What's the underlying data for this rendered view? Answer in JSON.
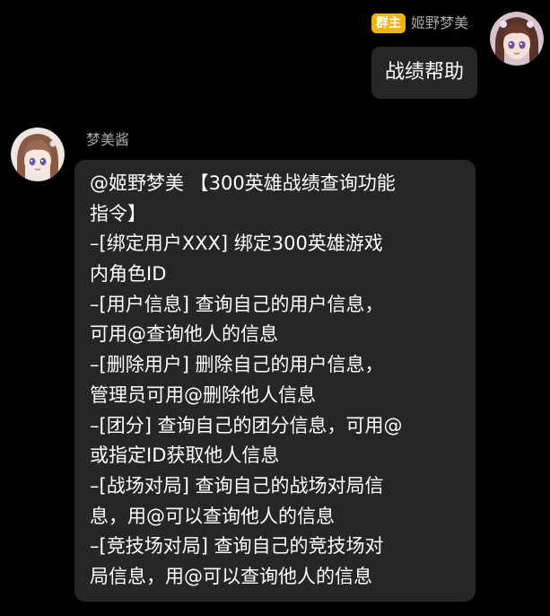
{
  "outgoing": {
    "badge": "群主",
    "sender": "姬野梦美",
    "text": "战绩帮助"
  },
  "incoming": {
    "sender": "梦美酱",
    "lines": [
      "@姬野梦美 【300英雄战绩查询功能",
      "指令】",
      "–[绑定用户XXX] 绑定300英雄游戏",
      "内角色ID",
      "–[用户信息] 查询自己的用户信息，",
      "可用@查询他人的信息",
      "–[删除用户] 删除自己的用户信息，",
      "管理员可用@删除他人信息",
      "–[团分] 查询自己的团分信息，可用@",
      "或指定ID获取他人信息",
      "–[战场对局] 查询自己的战场对局信",
      "息，用@可以查询他人的信息",
      "–[竞技场对局] 查询自己的竞技场对",
      "局信息，用@可以查询他人的信息"
    ]
  },
  "colors": {
    "background": "#000000",
    "bubble": "#262626",
    "badge": "#f2b20f",
    "name_text": "#a8a8a8",
    "message_text": "#ffffff"
  },
  "icons": {
    "sender_avatar": "anime-girl-avatar-icon",
    "bot_avatar": "anime-girl-avatar-icon"
  }
}
